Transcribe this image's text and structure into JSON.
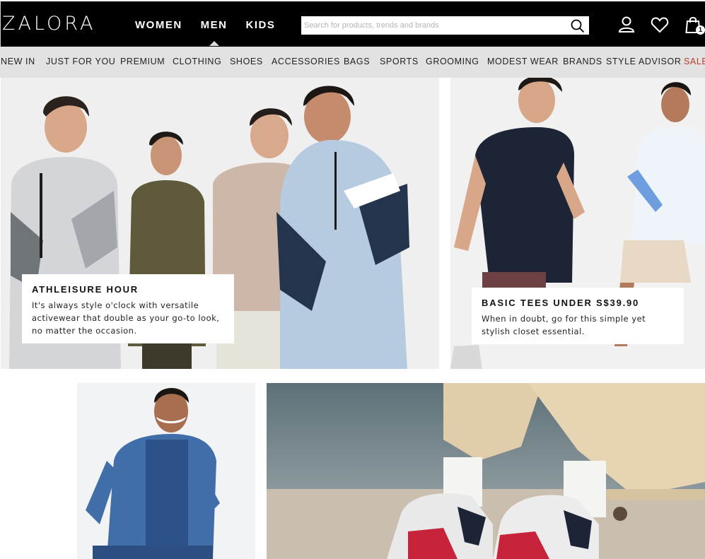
{
  "header": {
    "logo_text": "ZALORA",
    "gender_nav": [
      "WOMEN",
      "MEN",
      "KIDS"
    ],
    "active_gender": "MEN",
    "search_placeholder": "Search for products, trends and brands",
    "cart_count": "1",
    "icons": [
      "search-icon",
      "account-icon",
      "wishlist-heart-icon",
      "shopping-bag-icon"
    ]
  },
  "categories": [
    "NEW IN",
    "JUST FOR YOU",
    "PREMIUM",
    "CLOTHING",
    "SHOES",
    "ACCESSORIES",
    "BAGS",
    "SPORTS",
    "GROOMING",
    "MODEST WEAR",
    "BRANDS",
    "STYLE ADVISOR",
    "SALE"
  ],
  "promos": [
    {
      "title": "ATHLEISURE HOUR",
      "text": "It's always style o'clock with versatile activewear that double as your go-to look, no matter the occasion."
    },
    {
      "title": "BASIC TEES UNDER S$39.90",
      "text": "When in doubt, go for this simple yet stylish closet essential."
    }
  ],
  "colors": {
    "header_bg": "#000000",
    "nav_bg": "#e2e2e2",
    "sale": "#c0392b",
    "photo_bg": "#efefef"
  }
}
